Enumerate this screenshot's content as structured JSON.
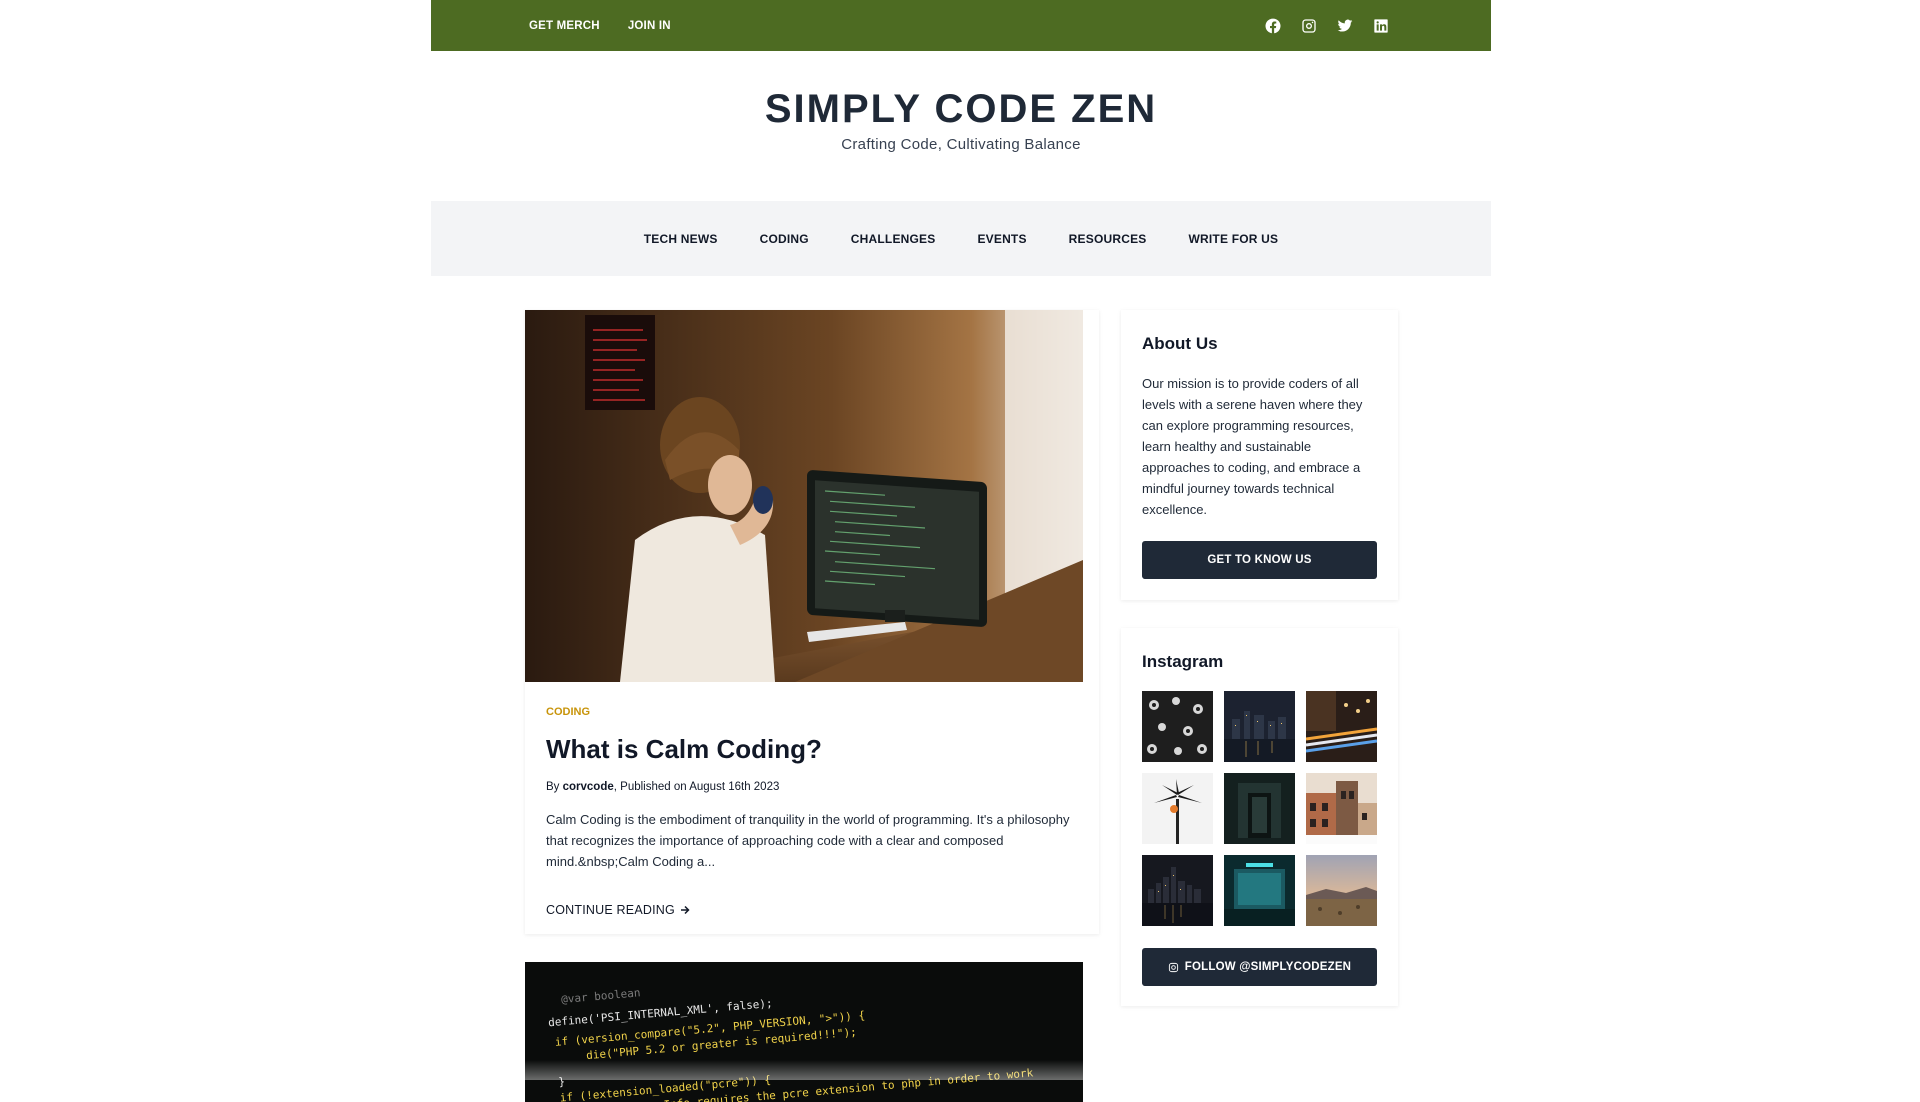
{
  "topbar": {
    "links": [
      "GET MERCH",
      "JOIN IN"
    ],
    "social_icons": [
      "facebook-icon",
      "instagram-icon",
      "twitter-icon",
      "linkedin-icon"
    ],
    "color": "#4d6b22"
  },
  "brand": {
    "title": "SIMPLY CODE ZEN",
    "tagline": "Crafting Code, Cultivating Balance"
  },
  "nav": {
    "items": [
      "TECH NEWS",
      "CODING",
      "CHALLENGES",
      "EVENTS",
      "RESOURCES",
      "WRITE FOR US"
    ]
  },
  "article": {
    "category": "CODING",
    "title": "What is Calm Coding?",
    "by": "By",
    "author": "corvcode",
    "published": ", Published on August 16th 2023",
    "excerpt": "Calm Coding is the embodiment of tranquility in the world of programming. It's a philosophy that recognizes the importance of approaching code with a clear and composed mind.&nbsp;Calm Coding a...",
    "continue_label": "CONTINUE READING",
    "accent": "#c8940a"
  },
  "second_article": {
    "code_lines": [
      "@var boolean",
      "define('PSI_INTERNAL_XML', false);",
      "if (version_compare(\"5.2\", PHP_VERSION, \">\")) {",
      "die(\"PHP 5.2 or greater is required!!!\");",
      "}",
      "if (!extension_loaded(\"pcre\")) {",
      "die(\"phpSysInfo requires the pcre extension to php in order to work"
    ]
  },
  "sidebar": {
    "about": {
      "heading": "About Us",
      "body": "Our mission is to provide coders of all levels with a serene haven where they can explore programming resources, learn healthy and sustainable approaches to coding, and embrace a mindful journey towards technical excellence.",
      "button": "GET TO KNOW US"
    },
    "instagram": {
      "heading": "Instagram",
      "button": "FOLLOW @SIMPLYCODEZEN",
      "thumbs": [
        "bolts-photo",
        "city-night-photo",
        "light-trails-photo",
        "palm-tree-photo",
        "dark-door-photo",
        "buildings-photo",
        "skyline-photo",
        "teal-storefront-photo",
        "desert-dusk-photo"
      ]
    },
    "button_color": "#1f2937"
  }
}
